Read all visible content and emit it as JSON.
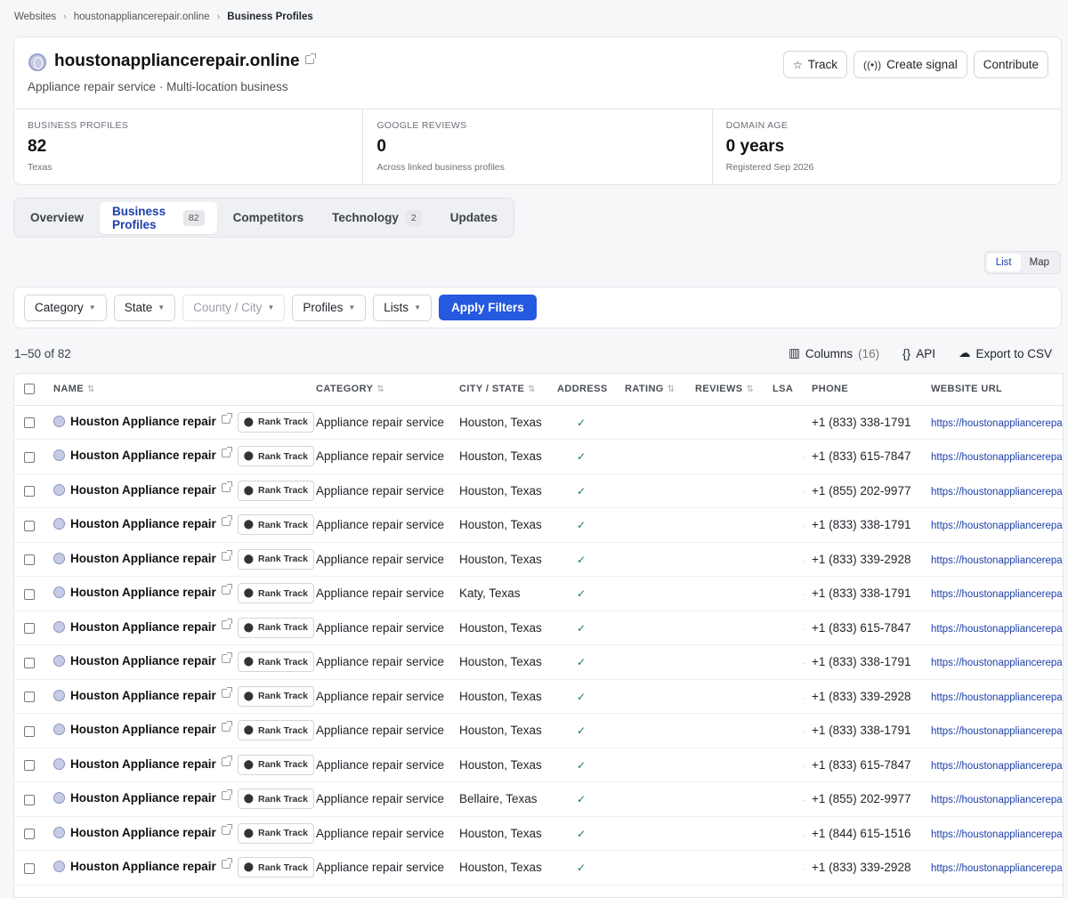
{
  "breadcrumb": [
    "Websites",
    "houstonappliancerepair.online",
    "Business Profiles"
  ],
  "header": {
    "title": "houstonappliancerepair.online",
    "subtitle": "Appliance repair service · Multi-location business",
    "buttons": {
      "track": "Track",
      "signal": "Create signal",
      "contribute": "Contribute"
    }
  },
  "stats": [
    {
      "label": "BUSINESS PROFILES",
      "value": "82",
      "sub": "Texas"
    },
    {
      "label": "GOOGLE REVIEWS",
      "value": "0",
      "sub": "Across linked business profiles"
    },
    {
      "label": "DOMAIN AGE",
      "value": "0 years",
      "sub": "Registered Sep 2026"
    }
  ],
  "tabs": [
    {
      "label": "Overview",
      "count": ""
    },
    {
      "label": "Business Profiles",
      "count": "82"
    },
    {
      "label": "Competitors",
      "count": ""
    },
    {
      "label": "Technology",
      "count": "2"
    },
    {
      "label": "Updates",
      "count": ""
    }
  ],
  "view_toggle": {
    "list": "List",
    "map": "Map"
  },
  "filters": {
    "category": "Category",
    "state": "State",
    "county_city": "County / City",
    "profiles": "Profiles",
    "lists": "Lists",
    "apply": "Apply Filters"
  },
  "results": {
    "range": "1–50 of 82",
    "columns_label": "Columns",
    "columns_count": "(16)",
    "api": "API",
    "export": "Export to CSV"
  },
  "table": {
    "headers": {
      "name": "NAME",
      "category": "CATEGORY",
      "city": "CITY / STATE",
      "address": "ADDRESS",
      "rating": "RATING",
      "reviews": "REVIEWS",
      "lsa": "LSA",
      "phone": "PHONE",
      "website": "WEBSITE URL"
    },
    "rank_label": "Rank Track",
    "rows": [
      {
        "name": "Houston Appliance repair",
        "category": "Appliance repair service",
        "city": "Houston, Texas",
        "phone": "+1 (833) 338-1791",
        "url": "https://houstonappliancerepair.online"
      },
      {
        "name": "Houston Appliance repair",
        "category": "Appliance repair service",
        "city": "Houston, Texas",
        "phone": "+1 (833) 615-7847",
        "url": "https://houstonappliancerepair.online"
      },
      {
        "name": "Houston Appliance repair",
        "category": "Appliance repair service",
        "city": "Houston, Texas",
        "phone": "+1 (855) 202-9977",
        "url": "https://houstonappliancerepair.online"
      },
      {
        "name": "Houston Appliance repair",
        "category": "Appliance repair service",
        "city": "Houston, Texas",
        "phone": "+1 (833) 338-1791",
        "url": "https://houstonappliancerepair.online"
      },
      {
        "name": "Houston Appliance repair",
        "category": "Appliance repair service",
        "city": "Houston, Texas",
        "phone": "+1 (833) 339-2928",
        "url": "https://houstonappliancerepair.online"
      },
      {
        "name": "Houston Appliance repair",
        "category": "Appliance repair service",
        "city": "Katy, Texas",
        "phone": "+1 (833) 338-1791",
        "url": "https://houstonappliancerepair.online"
      },
      {
        "name": "Houston Appliance repair",
        "category": "Appliance repair service",
        "city": "Houston, Texas",
        "phone": "+1 (833) 615-7847",
        "url": "https://houstonappliancerepair.online"
      },
      {
        "name": "Houston Appliance repair",
        "category": "Appliance repair service",
        "city": "Houston, Texas",
        "phone": "+1 (833) 338-1791",
        "url": "https://houstonappliancerepair.online"
      },
      {
        "name": "Houston Appliance repair",
        "category": "Appliance repair service",
        "city": "Houston, Texas",
        "phone": "+1 (833) 339-2928",
        "url": "https://houstonappliancerepair.online"
      },
      {
        "name": "Houston Appliance repair",
        "category": "Appliance repair service",
        "city": "Houston, Texas",
        "phone": "+1 (833) 338-1791",
        "url": "https://houstonappliancerepair.online"
      },
      {
        "name": "Houston Appliance repair",
        "category": "Appliance repair service",
        "city": "Houston, Texas",
        "phone": "+1 (833) 615-7847",
        "url": "https://houstonappliancerepair.online"
      },
      {
        "name": "Houston Appliance repair",
        "category": "Appliance repair service",
        "city": "Bellaire, Texas",
        "phone": "+1 (855) 202-9977",
        "url": "https://houstonappliancerepair.online"
      },
      {
        "name": "Houston Appliance repair",
        "category": "Appliance repair service",
        "city": "Houston, Texas",
        "phone": "+1 (844) 615-1516",
        "url": "https://houstonappliancerepair.online"
      },
      {
        "name": "Houston Appliance repair",
        "category": "Appliance repair service",
        "city": "Houston, Texas",
        "phone": "+1 (833) 339-2928",
        "url": "https://houstonappliancerepair.online"
      }
    ]
  }
}
